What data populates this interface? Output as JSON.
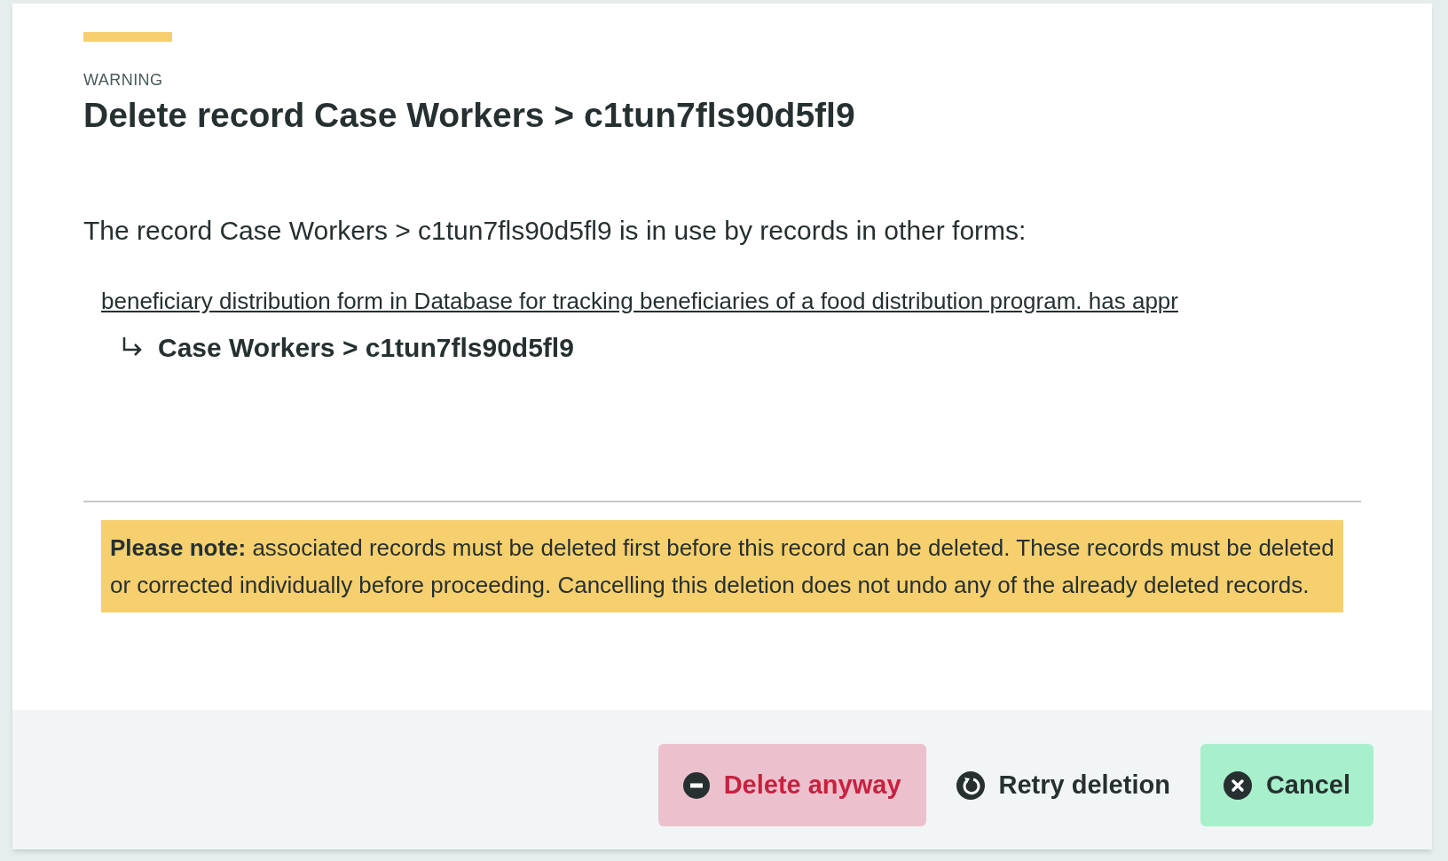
{
  "dialog": {
    "eyebrow": "WARNING",
    "title": "Delete record Case Workers > c1tun7fls90d5fl9",
    "message": "The record Case Workers > c1tun7fls90d5fl9 is in use by records in other forms:",
    "references": [
      {
        "link": "beneficiary distribution form in Database for tracking beneficiaries of a food distribution program. has appr",
        "record": "Case Workers > c1tun7fls90d5fl9"
      }
    ],
    "note": "**Please note:** associated records must be deleted first before this record can be deleted. These records must be deleted or corrected individually before proceeding. Cancelling this deletion does not undo any of the already deleted records.",
    "buttons": [
      {
        "label": "Delete anyway",
        "kind": "danger"
      },
      {
        "label": "Retry deletion",
        "kind": "retry"
      },
      {
        "label": "Cancel",
        "kind": "cancel"
      }
    ]
  }
}
